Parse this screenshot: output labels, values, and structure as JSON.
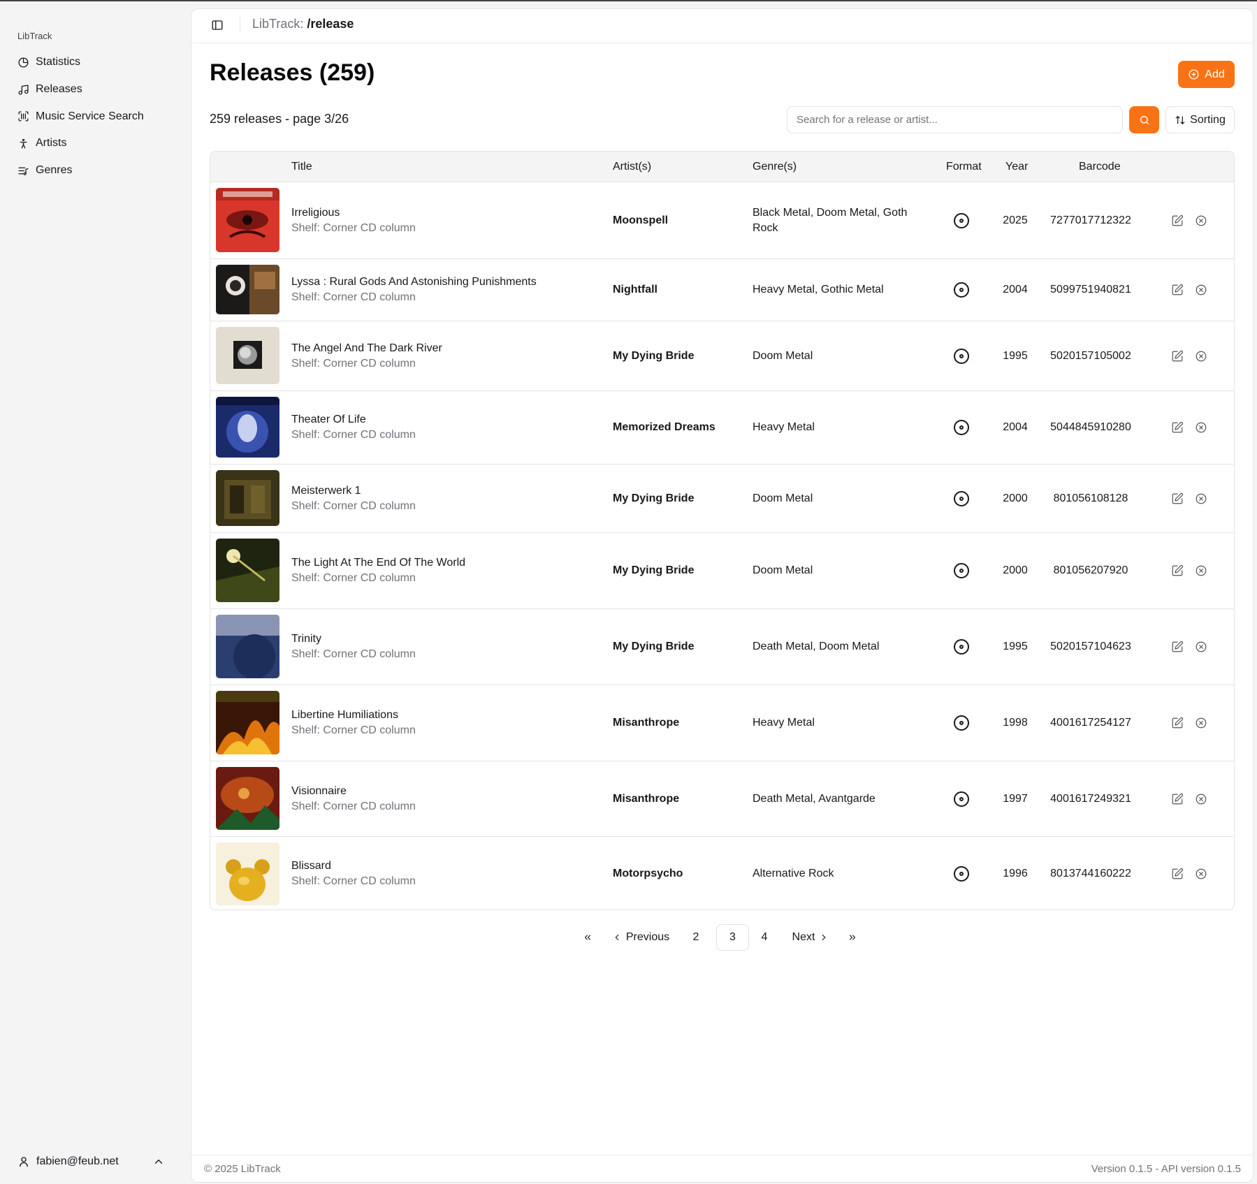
{
  "app": {
    "brand": "LibTrack"
  },
  "sidebar": {
    "items": [
      {
        "label": "Statistics",
        "icon": "pie-chart-icon"
      },
      {
        "label": "Releases",
        "icon": "music-note-icon"
      },
      {
        "label": "Music Service Search",
        "icon": "scan-barcode-icon"
      },
      {
        "label": "Artists",
        "icon": "person-icon"
      },
      {
        "label": "Genres",
        "icon": "list-music-icon"
      }
    ],
    "user_email": "fabien@feub.net"
  },
  "header": {
    "crumb_prefix": "LibTrack:",
    "crumb_path": "/release"
  },
  "main": {
    "title": "Releases (259)",
    "add_label": "Add",
    "summary": "259 releases - page 3/26",
    "search_placeholder": "Search for a release or artist...",
    "sorting_label": "Sorting",
    "accent_color": "#f97316"
  },
  "table": {
    "columns": [
      "Title",
      "Artist(s)",
      "Genre(s)",
      "Format",
      "Year",
      "Barcode"
    ],
    "rows": [
      {
        "title": "Irreligious",
        "shelf": "Shelf: Corner CD column",
        "artist": "Moonspell",
        "genres": "Black Metal, Doom Metal, Goth Rock",
        "format": "cd-icon",
        "year": "2025",
        "barcode": "7277017712322"
      },
      {
        "title": "Lyssa : Rural Gods And Astonishing Punishments",
        "shelf": "Shelf: Corner CD column",
        "artist": "Nightfall",
        "genres": "Heavy Metal, Gothic Metal",
        "format": "cd-icon",
        "year": "2004",
        "barcode": "5099751940821"
      },
      {
        "title": "The Angel And The Dark River",
        "shelf": "Shelf: Corner CD column",
        "artist": "My Dying Bride",
        "genres": "Doom Metal",
        "format": "cd-icon",
        "year": "1995",
        "barcode": "5020157105002"
      },
      {
        "title": "Theater Of Life",
        "shelf": "Shelf: Corner CD column",
        "artist": "Memorized Dreams",
        "genres": "Heavy Metal",
        "format": "cd-icon",
        "year": "2004",
        "barcode": "5044845910280"
      },
      {
        "title": "Meisterwerk 1",
        "shelf": "Shelf: Corner CD column",
        "artist": "My Dying Bride",
        "genres": "Doom Metal",
        "format": "cd-icon",
        "year": "2000",
        "barcode": "801056108128"
      },
      {
        "title": "The Light At The End Of The World",
        "shelf": "Shelf: Corner CD column",
        "artist": "My Dying Bride",
        "genres": "Doom Metal",
        "format": "cd-icon",
        "year": "2000",
        "barcode": "801056207920"
      },
      {
        "title": "Trinity",
        "shelf": "Shelf: Corner CD column",
        "artist": "My Dying Bride",
        "genres": "Death Metal, Doom Metal",
        "format": "cd-icon",
        "year": "1995",
        "barcode": "5020157104623"
      },
      {
        "title": "Libertine Humiliations",
        "shelf": "Shelf: Corner CD column",
        "artist": "Misanthrope",
        "genres": "Heavy Metal",
        "format": "cd-icon",
        "year": "1998",
        "barcode": "4001617254127"
      },
      {
        "title": "Visionnaire",
        "shelf": "Shelf: Corner CD column",
        "artist": "Misanthrope",
        "genres": "Death Metal, Avantgarde",
        "format": "cd-icon",
        "year": "1997",
        "barcode": "4001617249321"
      },
      {
        "title": "Blissard",
        "shelf": "Shelf: Corner CD column",
        "artist": "Motorpsycho",
        "genres": "Alternative Rock",
        "format": "cd-icon",
        "year": "1996",
        "barcode": "8013744160222"
      }
    ]
  },
  "pagination": {
    "previous_label": "Previous",
    "next_label": "Next",
    "pages": [
      "2",
      "3",
      "4"
    ],
    "current": "3"
  },
  "footer": {
    "copyright": "© 2025 LibTrack",
    "version": "Version 0.1.5 - API version 0.1.5"
  }
}
